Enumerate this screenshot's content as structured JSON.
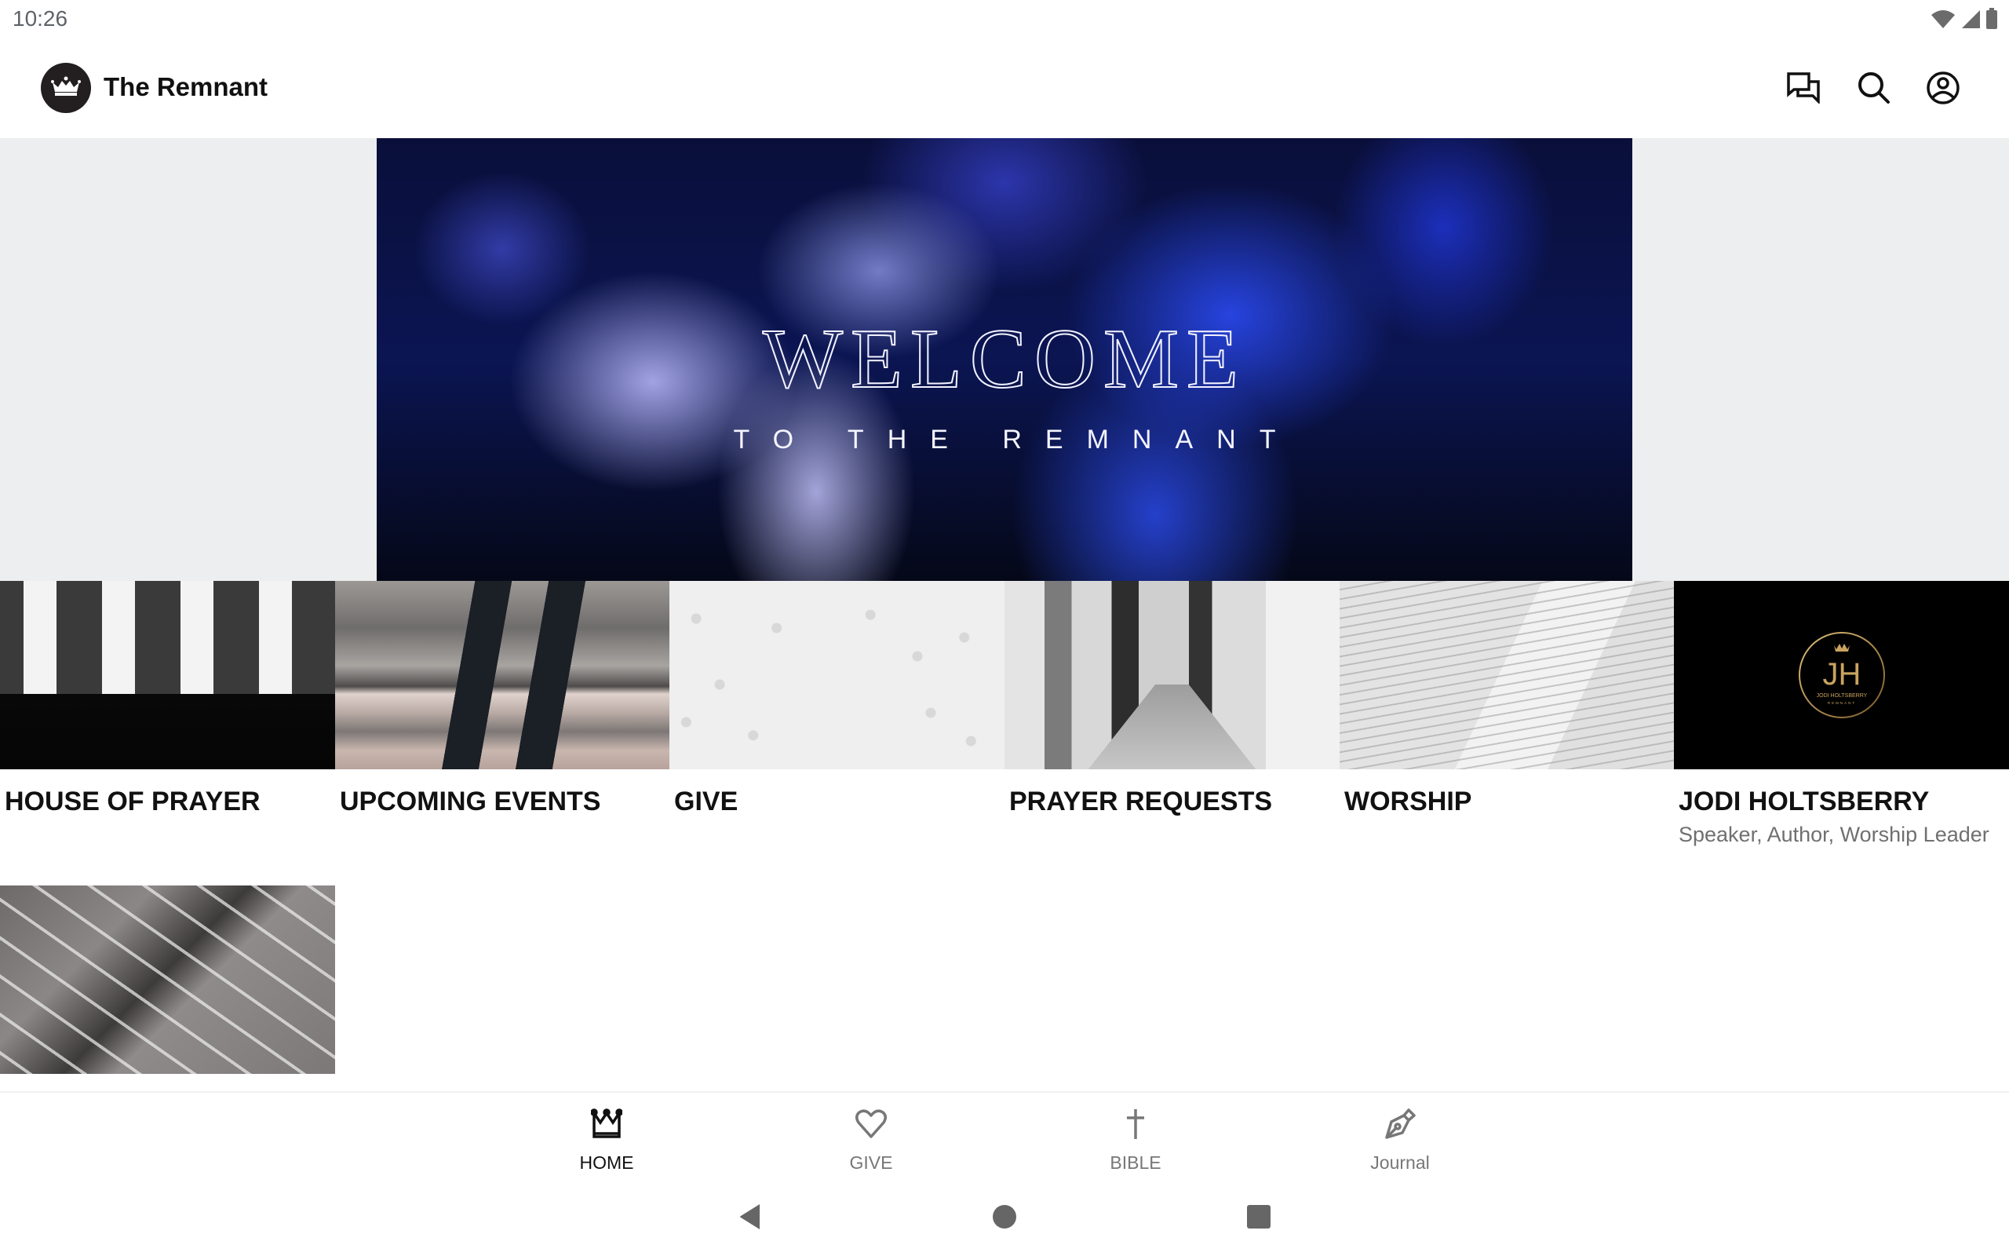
{
  "status_bar": {
    "time": "10:26",
    "icons": [
      "wifi-icon",
      "cell-signal-icon",
      "battery-icon"
    ]
  },
  "app_bar": {
    "title": "The Remnant",
    "logo_icon": "crown-icon",
    "actions": [
      {
        "name": "chat",
        "icon": "chat-bubbles-icon"
      },
      {
        "name": "search",
        "icon": "search-icon"
      },
      {
        "name": "account",
        "icon": "account-circle-icon"
      }
    ]
  },
  "banner": {
    "headline": "WELCOME",
    "subline": "TO THE REMNANT"
  },
  "tiles": [
    {
      "label": "HOUSE OF PRAYER",
      "subtitle": ""
    },
    {
      "label": "UPCOMING EVENTS",
      "subtitle": ""
    },
    {
      "label": "GIVE",
      "subtitle": ""
    },
    {
      "label": "PRAYER REQUESTS",
      "subtitle": ""
    },
    {
      "label": "WORSHIP",
      "subtitle": ""
    },
    {
      "label": "JODI HOLTSBERRY",
      "subtitle": "Speaker, Author, Worship Leader",
      "logo": {
        "monogram": "JH",
        "name": "JODI HOLTSBERRY",
        "tagline": "REMNANT"
      }
    },
    {
      "label": "",
      "subtitle": ""
    }
  ],
  "bottom_nav": {
    "items": [
      {
        "label": "HOME",
        "icon": "crown-icon",
        "active": true
      },
      {
        "label": "GIVE",
        "icon": "heart-icon",
        "active": false
      },
      {
        "label": "BIBLE",
        "icon": "cross-icon",
        "active": false
      },
      {
        "label": "Journal",
        "icon": "fountain-pen-icon",
        "active": false
      }
    ]
  },
  "colors": {
    "text_primary": "#111111",
    "text_secondary": "#707070",
    "nav_inactive": "#777777",
    "logo_bg": "#231f20",
    "banner_side_bg": "#eceeef",
    "jh_gold": "#c9a35f"
  }
}
